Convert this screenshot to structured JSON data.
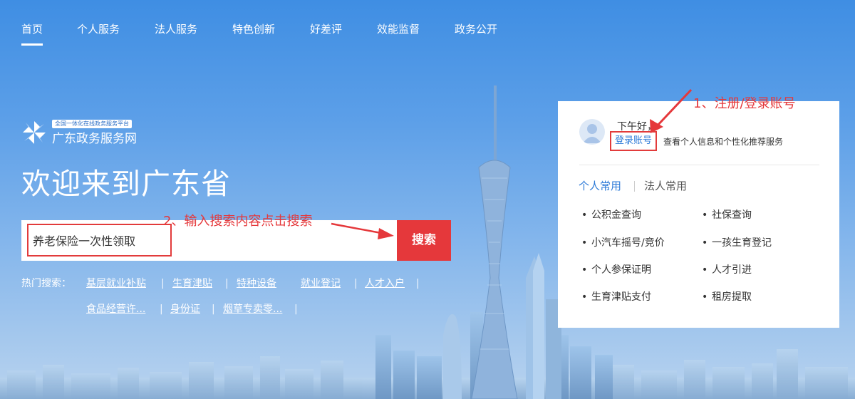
{
  "nav": {
    "items": [
      {
        "label": "首页"
      },
      {
        "label": "个人服务"
      },
      {
        "label": "法人服务"
      },
      {
        "label": "特色创新"
      },
      {
        "label": "好差评"
      },
      {
        "label": "效能监督"
      },
      {
        "label": "政务公开"
      }
    ],
    "active_index": 0
  },
  "logo": {
    "badge_text": "全国一体化在线政务服务平台",
    "name": "广东政务服务网",
    "icon": "pinwheel-logo-icon"
  },
  "hero": {
    "welcome": "欢迎来到广东省"
  },
  "search": {
    "value": "养老保险一次性领取",
    "button_label": "搜索"
  },
  "hot_search": {
    "label": "热门搜索：",
    "links": [
      "基层就业补贴",
      "生育津贴",
      "特种设备",
      "就业登记",
      "人才入户",
      "食品经营许...",
      "身份证",
      "烟草专卖零..."
    ]
  },
  "user_panel": {
    "greeting": "下午好，",
    "login_label": "登录账号",
    "login_desc": "查看个人信息和个性化推荐服务",
    "avatar_icon": "user-avatar-icon",
    "tabs": [
      {
        "label": "个人常用",
        "active": true
      },
      {
        "label": "法人常用",
        "active": false
      }
    ],
    "services": [
      "公积金查询",
      "社保查询",
      "小汽车摇号/竞价",
      "一孩生育登记",
      "个人参保证明",
      "人才引进",
      "生育津贴支付",
      "租房提取"
    ]
  },
  "annotations": {
    "step1": "1、注册/登录账号",
    "step2": "2、输入搜索内容点击搜索"
  },
  "colors": {
    "accent_red": "#e5383b",
    "link_blue": "#2e7bd8",
    "sky_top": "#3f8ee3"
  }
}
